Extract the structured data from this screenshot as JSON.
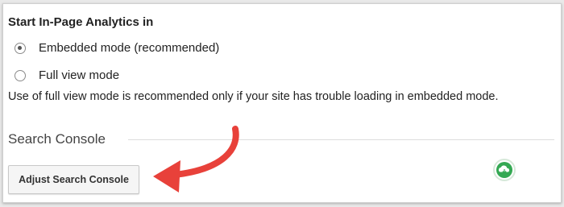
{
  "analytics": {
    "title": "Start In-Page Analytics in",
    "options": [
      {
        "label": "Embedded mode (recommended)",
        "selected": true
      },
      {
        "label": "Full view mode",
        "selected": false
      }
    ],
    "help_text": "Use of full view mode is recommended only if your site has trouble loading in embedded mode."
  },
  "search_console": {
    "title": "Search Console",
    "button_label": "Adjust Search Console"
  },
  "icons": {
    "cloud": "cloud-icon",
    "annotation_arrow": "red-arrow-icon"
  },
  "colors": {
    "arrow": "#e8413a",
    "cloud_icon": "#34a853"
  }
}
